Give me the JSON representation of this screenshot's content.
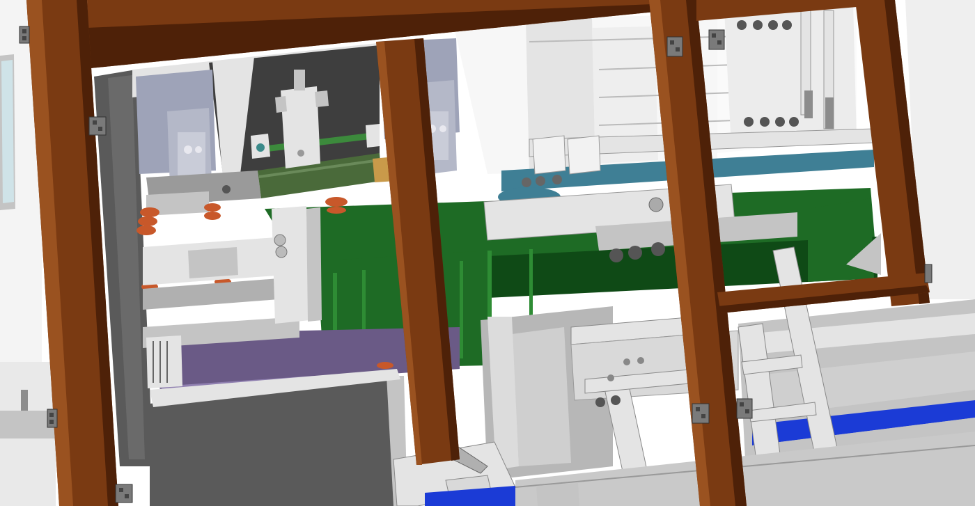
{
  "scene": {
    "colors": {
      "background": "#ffffff",
      "frame_wood": "#7a3a12",
      "frame_wood_dark": "#4e2108",
      "frame_wood_light": "#9a5220",
      "conveyor_green": "#1e6b25",
      "conveyor_green_dark": "#0f4a16",
      "metal_light": "#e4e4e4",
      "metal_mid": "#c4c4c4",
      "metal_dark": "#8c8c8c",
      "slate": "#9ea3b8",
      "charcoal": "#3e3e3e",
      "dark_panel": "#5a5a5a",
      "suction_cup": "#c8582a",
      "teal_belt": "#3f7f95",
      "blue_belt": "#1b3bd6",
      "purple_floor": "#6a5a86",
      "brass": "#c99a4a",
      "rod_green": "#3c8a3c"
    }
  }
}
